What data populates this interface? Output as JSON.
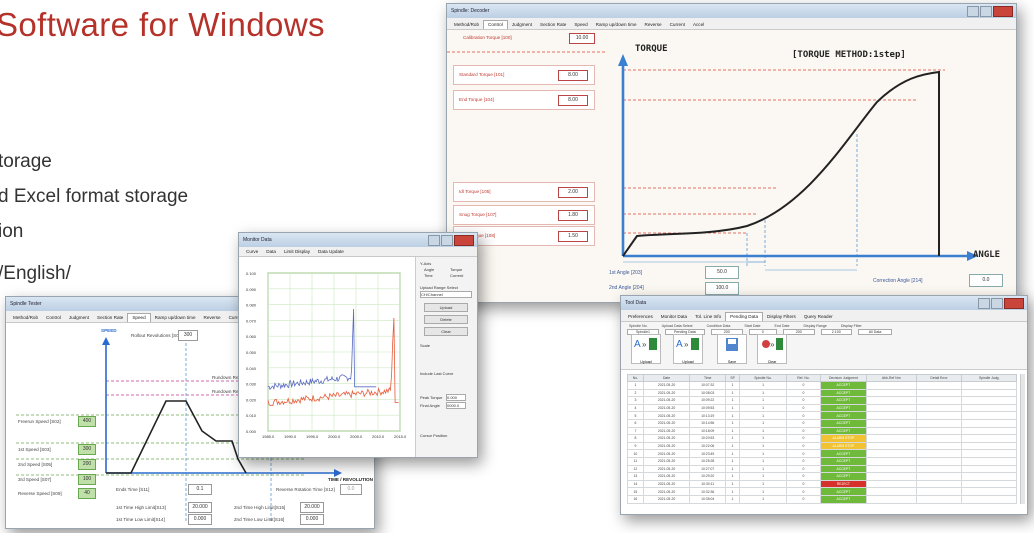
{
  "hero": {
    "title": "Software for Windows",
    "features": [
      "torage",
      "d Excel format storage",
      "ion",
      "/English/"
    ]
  },
  "torque_window": {
    "title": "Spindle: Decoder",
    "tabs": [
      "Method/Rob",
      "Control",
      "Judgment",
      "Section Rate",
      "Speed",
      "Ramp up/down time",
      "Reverse",
      "Current",
      "Accel"
    ],
    "active_tab": "Control",
    "panels": [
      {
        "label": "Calibration Torque [100]",
        "value": "10.00"
      },
      {
        "label": "Standard Torque [101]",
        "value": "8.00"
      },
      {
        "label": "End Torque [104]",
        "value": "8.00"
      },
      {
        "label": "Idl Torque [105]",
        "value": "2.00"
      },
      {
        "label": "Snug Torque [107]",
        "value": "1.80"
      },
      {
        "label": "Seat Torque [108]",
        "value": "1.50"
      }
    ],
    "axis_torque": "TORQUE",
    "axis_angle": "ANGLE",
    "method": "[TORQUE METHOD:1step]",
    "angles": [
      {
        "label": "1st Angle [203]",
        "value": "50.0"
      },
      {
        "label": "2nd Angle [204]",
        "value": "100.0"
      }
    ],
    "correction": {
      "label": "Correction Angle [214]",
      "value": "0.0"
    }
  },
  "monitor_window": {
    "title": "Monitor Data",
    "menu": [
      "Curve",
      "Data",
      "Limit Display",
      "Data Update"
    ],
    "tick_y": [
      "0.100",
      "0.090",
      "0.080",
      "0.070",
      "0.060",
      "0.050",
      "0.040",
      "0.030",
      "0.020",
      "0.010",
      "0.000"
    ],
    "tick_x": [
      "1985.0",
      "1990.0",
      "1995.0",
      "2000.0",
      "2005.0",
      "2010.0",
      "2015.0"
    ],
    "side": {
      "y_axis": "Y-Axis",
      "opt_angle": "Angle",
      "opt_time": "Time",
      "opt_torque": "Torque",
      "opt_current": "Current",
      "upload_header": "Upload Range Select",
      "upload_sel": "CH/Channel",
      "btn_upload": "Upload",
      "btn_delete": "Delete",
      "btn_clear": "Clear",
      "scale": "Scale",
      "include_last": "Include Last Curve",
      "peak_torque_lbl": "Peak Torque",
      "peak_torque": "0.000",
      "final_angle_lbl": "Final Angle",
      "final_angle": "0000.0",
      "cursor_position": "Cursor Position"
    }
  },
  "speed_window": {
    "title": "Spindle Tester",
    "tabs": [
      "Method/Rob",
      "Control",
      "Judgment",
      "Section Rate",
      "Speed",
      "Ramp up/down time",
      "Reverse",
      "Current",
      "Accel"
    ],
    "active_tab": "Speed",
    "axis_speed": "SPEED",
    "axis_time": "TIME / REVOLUTION",
    "top_field_label": "Rollout Revolutions [S01]",
    "top_field_value": "300",
    "marker_labels": [
      "Rundown Revolu",
      "Rundown Revolu"
    ],
    "left_labels": [
      {
        "label": "Freerun Speed [S02]",
        "value": "400"
      },
      {
        "label": "1st Speed [S03]",
        "value": "300"
      },
      {
        "label": "2nd Speed [S05]",
        "value": "200"
      },
      {
        "label": "3rd Speed [S07]",
        "value": "100"
      },
      {
        "label": "Reverse Speed [S09]",
        "value": "40"
      }
    ],
    "bottom": [
      {
        "label": "Ends Time [S11]",
        "value": "0.1"
      },
      {
        "label": "Reverse Rotation Time [S12]",
        "value": "0.0"
      },
      {
        "label": "1st Time High Limit[S13]",
        "value": "20.000"
      },
      {
        "label": "1st Time Low Limit[S14]",
        "value": "0.000"
      },
      {
        "label": "2nd Time High Limit[S15]",
        "value": "20.000"
      },
      {
        "label": "2nd Time Low Limit[S16]",
        "value": "0.000"
      }
    ]
  },
  "table_window": {
    "title": "Tool Data",
    "menu": [
      "Preferences",
      "Monitor Data",
      "Tol. Line Info",
      "Pending Data",
      "Display Filters",
      "Query Reader"
    ],
    "active_tab": "Pending Data",
    "filters": [
      "Spindle No.",
      "Upload Data Select",
      "Condition Data",
      "Start Date",
      "End Date",
      "Display Range",
      "Display Filter"
    ],
    "filter_values": [
      "Spindle1",
      "Pending Data",
      "200",
      "0",
      "200",
      "2.100",
      "All Data"
    ],
    "tools": [
      "Upload",
      "Upload",
      "Save",
      "Clear"
    ],
    "columns": [
      "No.",
      "Date",
      "Time",
      "SP",
      "Spindle No.",
      "Ref. No.",
      "Decision Judgment",
      "Abb-Ref Nm",
      "Detail Error",
      "Spindle Judg."
    ],
    "rows": [
      {
        "no": "1",
        "date": "2021-05-20",
        "time": "10:07:32",
        "sp": "1",
        "ref": "0",
        "res": "ACCEPT",
        "status": "ok"
      },
      {
        "no": "2",
        "date": "2021-05-20",
        "time": "10:08:03",
        "sp": "1",
        "ref": "0",
        "res": "ACCEPT",
        "status": "ok"
      },
      {
        "no": "3",
        "date": "2021-05-20",
        "time": "10:09:22",
        "sp": "1",
        "ref": "0",
        "res": "ACCEPT",
        "status": "ok"
      },
      {
        "no": "4",
        "date": "2021-05-20",
        "time": "10:09:53",
        "sp": "1",
        "ref": "0",
        "res": "ACCEPT",
        "status": "ok"
      },
      {
        "no": "5",
        "date": "2021-05-20",
        "time": "10:13:19",
        "sp": "1",
        "ref": "0",
        "res": "ACCEPT",
        "status": "ok"
      },
      {
        "no": "6",
        "date": "2021-05-20",
        "time": "10:14:56",
        "sp": "1",
        "ref": "0",
        "res": "ACCEPT",
        "status": "ok"
      },
      {
        "no": "7",
        "date": "2021-05-20",
        "time": "10:18:09",
        "sp": "1",
        "ref": "0",
        "res": "ACCEPT",
        "status": "ok"
      },
      {
        "no": "8",
        "date": "2021-05-20",
        "time": "10:20:53",
        "sp": "1",
        "ref": "0",
        "res": "ALARM STOP",
        "status": "warn"
      },
      {
        "no": "9",
        "date": "2021-05-20",
        "time": "10:22:06",
        "sp": "1",
        "ref": "0",
        "res": "ALARM STOP",
        "status": "warn"
      },
      {
        "no": "10",
        "date": "2021-05-20",
        "time": "10:23:49",
        "sp": "1",
        "ref": "0",
        "res": "ACCEPT",
        "status": "ok"
      },
      {
        "no": "11",
        "date": "2021-05-20",
        "time": "10:25:28",
        "sp": "1",
        "ref": "0",
        "res": "ACCEPT",
        "status": "ok"
      },
      {
        "no": "12",
        "date": "2021-05-20",
        "time": "10:27:07",
        "sp": "1",
        "ref": "0",
        "res": "ACCEPT",
        "status": "ok"
      },
      {
        "no": "13",
        "date": "2021-05-20",
        "time": "10:29:20",
        "sp": "1",
        "ref": "0",
        "res": "ACCEPT",
        "status": "ok"
      },
      {
        "no": "14",
        "date": "2021-05-20",
        "time": "10:30:11",
        "sp": "1",
        "ref": "0",
        "res": "REJECT",
        "status": "ng"
      },
      {
        "no": "15",
        "date": "2021-05-20",
        "time": "10:32:36",
        "sp": "1",
        "ref": "0",
        "res": "ACCEPT",
        "status": "ok"
      },
      {
        "no": "16",
        "date": "2021-05-20",
        "time": "10:35:04",
        "sp": "1",
        "ref": "0",
        "res": "ACCEPT",
        "status": "ok"
      }
    ]
  },
  "colors": {
    "title_red": "#b4322a",
    "curve_dark": "#222222",
    "limit_red": "#e0443a",
    "guide_blue": "#5b9bd5",
    "series_blue": "#5a6cc2",
    "series_red": "#e85a3a",
    "ok_green": "#6fba3a",
    "warn_yellow": "#f1c232",
    "ng_red": "#d6322b"
  }
}
